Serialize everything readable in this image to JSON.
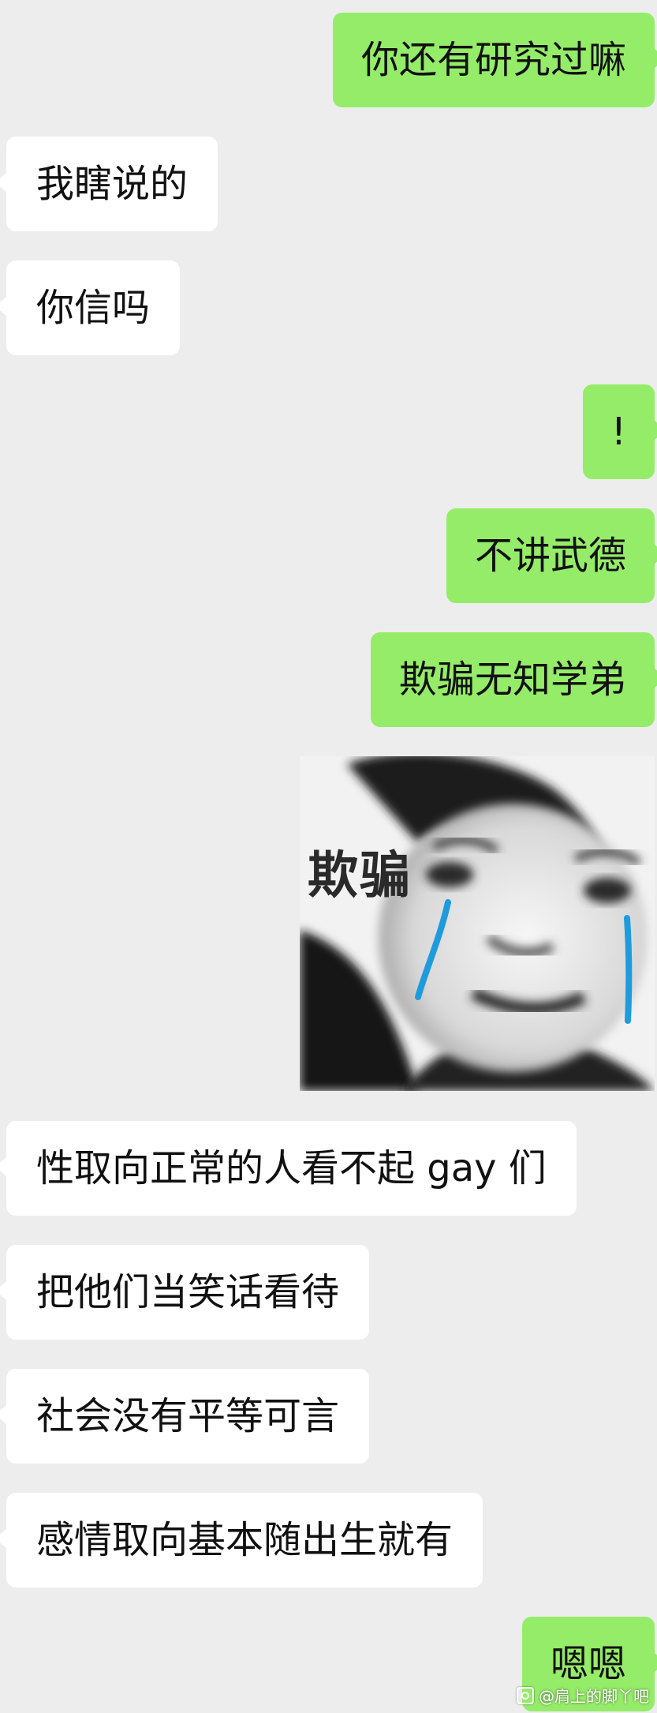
{
  "messages": [
    {
      "side": "right",
      "text": "你还有研究过嘛"
    },
    {
      "side": "left",
      "text": "我瞎说的"
    },
    {
      "side": "left",
      "text": "你信吗"
    },
    {
      "side": "right",
      "text": "!"
    },
    {
      "side": "right",
      "text": "不讲武德"
    },
    {
      "side": "right",
      "text": "欺骗无知学弟"
    },
    {
      "side": "right",
      "type": "sticker",
      "text": "欺骗"
    },
    {
      "side": "left",
      "text": "性取向正常的人看不起 gay 们"
    },
    {
      "side": "left",
      "text": "把他们当笑话看待"
    },
    {
      "side": "left",
      "text": "社会没有平等可言"
    },
    {
      "side": "left",
      "text": "感情取向基本随出生就有"
    },
    {
      "side": "right",
      "text": "嗯嗯"
    }
  ],
  "sticker": {
    "caption": "欺骗",
    "tear_color": "#1e9bdc"
  },
  "watermark": {
    "text": "@肩上的脚丫吧",
    "icon": "tieba-logo-icon"
  },
  "colors": {
    "background": "#ededed",
    "bubble_outgoing": "#95ec69",
    "bubble_incoming": "#ffffff"
  }
}
